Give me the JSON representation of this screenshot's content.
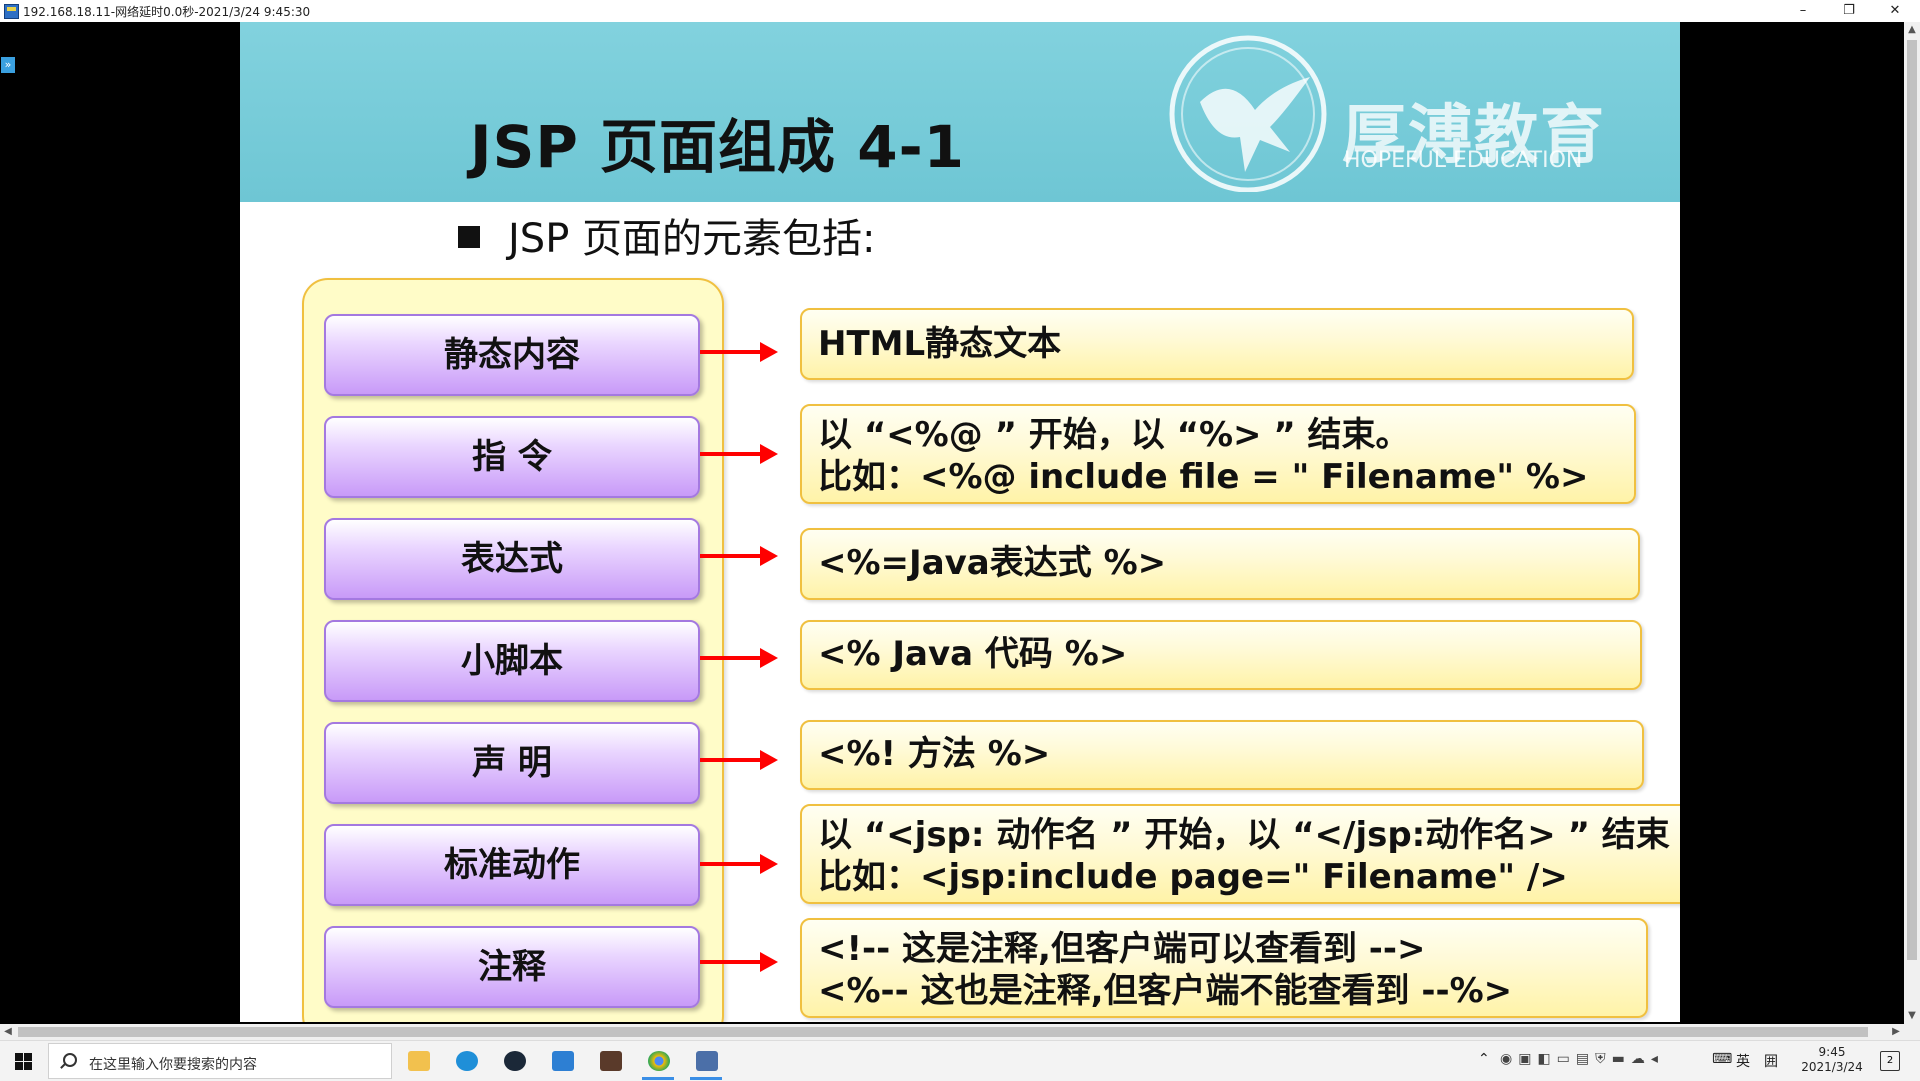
{
  "window": {
    "title": "192.168.18.11-网络延时0.0秒-2021/3/24 9:45:30",
    "minimize_glyph": "–",
    "restore_glyph": "❐",
    "close_glyph": "✕"
  },
  "slide": {
    "title": "JSP 页面组成 4-1",
    "bullet": "JSP 页面的元素包括:",
    "logo": {
      "cn": "厚溥教育",
      "en": "HOPEFUL   EDUCATION",
      "icon": "bird-emblem-icon"
    },
    "rows": [
      {
        "label": "静态内容",
        "desc_l1": "HTML静态文本",
        "desc_l2": ""
      },
      {
        "label": "指 令",
        "desc_l1": "以 “<%@ ” 开始，以 “%> ” 结束。",
        "desc_l2": "比如：<%@ include file = \" Filename\" %>"
      },
      {
        "label": "表达式",
        "desc_l1": "<%=Java表达式 %>",
        "desc_l2": ""
      },
      {
        "label": "小脚本",
        "desc_l1": "<% Java 代码 %>",
        "desc_l2": ""
      },
      {
        "label": "声 明",
        "desc_l1": "<%! 方法 %>",
        "desc_l2": ""
      },
      {
        "label": "标准动作",
        "desc_l1": "以 “<jsp: 动作名 ”  开始，以 “</jsp:动作名> ” 结束",
        "desc_l2": "比如：<jsp:include page=\" Filename\" />"
      },
      {
        "label": "注释",
        "desc_l1": "<!-- 这是注释,但客户端可以查看到 -->",
        "desc_l2": "<%-- 这也是注释,但客户端不能查看到 --%>"
      }
    ]
  },
  "taskbar": {
    "search_placeholder": "在这里输入你要搜索的内容",
    "apps": [
      "file-explorer-icon",
      "edge-icon",
      "steam-icon",
      "app-icon",
      "game-icon",
      "chrome-icon",
      "remote-desktop-icon"
    ],
    "tray_lang": "英",
    "tray_ime": "囲",
    "time": "9:45",
    "date": "2021/3/24",
    "notifications_count": "2"
  },
  "colors": {
    "header": "#6ec6d4",
    "arrow": "#ff0000",
    "purple_border": "#a479e0",
    "yellow_border": "#f0c040"
  }
}
